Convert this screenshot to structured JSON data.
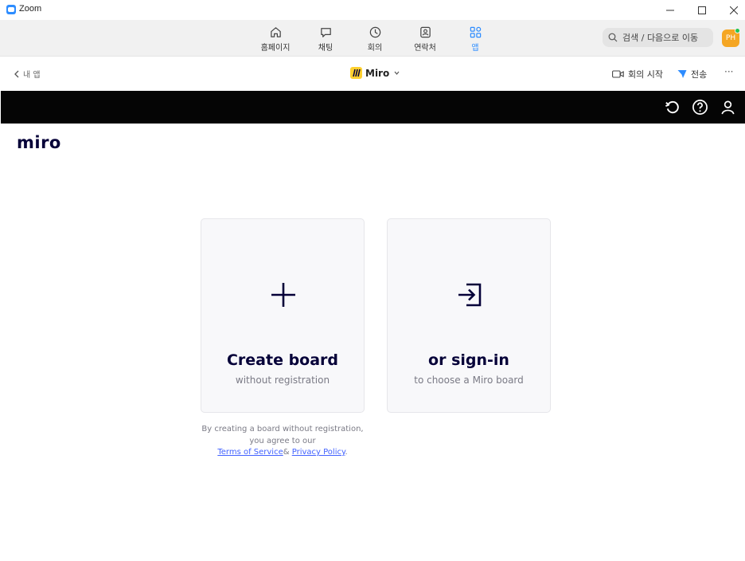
{
  "window": {
    "title": "Zoom"
  },
  "nav": {
    "items": [
      {
        "label": "홈페이지",
        "icon": "home-icon"
      },
      {
        "label": "채팅",
        "icon": "chat-icon"
      },
      {
        "label": "회의",
        "icon": "clock-icon"
      },
      {
        "label": "연락처",
        "icon": "contacts-icon"
      },
      {
        "label": "앱",
        "icon": "apps-icon",
        "active": true
      }
    ],
    "search_text": "검색 / 다음으로 이동",
    "avatar_initials": "PH"
  },
  "app_header": {
    "back_label": "내 앱",
    "app_name": "Miro",
    "meeting_label": "회의 시작",
    "send_label": "전송",
    "more_label": "···"
  },
  "miro": {
    "logo_text": "miro",
    "create_card": {
      "title": "Create board",
      "subtitle": "without registration"
    },
    "signin_card": {
      "title": "or sign-in",
      "subtitle": "to choose a Miro board"
    },
    "legal": {
      "text": "By creating a board without registration, you agree to our",
      "terms_link": "Terms of Service",
      "amp": "&",
      "privacy_link": "Privacy Policy",
      "period": "."
    }
  },
  "colors": {
    "zoom_blue": "#2D8CFF",
    "miro_yellow": "#FFD02F",
    "miro_navy": "#050038",
    "link_blue": "#4262ff",
    "avatar_orange": "#f5a623"
  }
}
